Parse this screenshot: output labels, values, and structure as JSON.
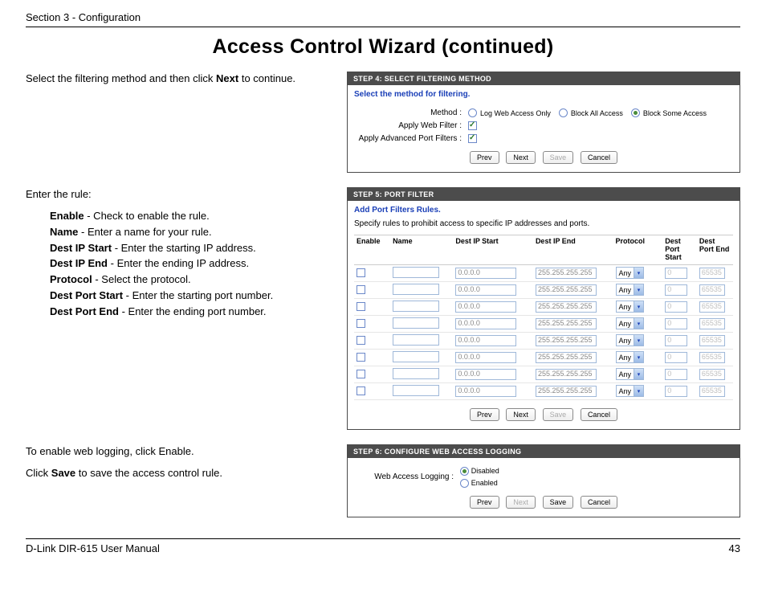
{
  "header": {
    "section": "Section 3 - Configuration"
  },
  "title": "Access Control Wizard (continued)",
  "left": {
    "intro_pre": "Select the filtering method and then click ",
    "intro_bold": "Next",
    "intro_post": " to continue.",
    "rule_intro": "Enter the rule:",
    "defs": [
      {
        "term": "Enable",
        "desc": " - Check to enable the rule."
      },
      {
        "term": "Name",
        "desc": " - Enter a name for your rule."
      },
      {
        "term": "Dest IP Start",
        "desc": " - Enter the starting IP address."
      },
      {
        "term": "Dest IP End",
        "desc": " - Enter the ending IP address."
      },
      {
        "term": "Protocol",
        "desc": " - Select the protocol."
      },
      {
        "term": "Dest Port Start",
        "desc": " - Enter the starting port number."
      },
      {
        "term": "Dest Port End",
        "desc": " - Enter the ending port number."
      }
    ],
    "logging_p1": "To enable web logging, click Enable.",
    "logging_p2_pre": "Click ",
    "logging_p2_bold": "Save",
    "logging_p2_post": " to save the access control rule."
  },
  "step4": {
    "title": "STEP 4: SELECT FILTERING METHOD",
    "subtitle": "Select the method for filtering.",
    "method_label": "Method :",
    "options": [
      "Log Web Access Only",
      "Block All Access",
      "Block Some Access"
    ],
    "selected": 2,
    "apply_web_label": "Apply Web Filter :",
    "apply_web_checked": true,
    "apply_port_label": "Apply Advanced Port Filters :",
    "apply_port_checked": true,
    "buttons": {
      "prev": "Prev",
      "next": "Next",
      "save": "Save",
      "cancel": "Cancel"
    }
  },
  "step5": {
    "title": "STEP 5: PORT FILTER",
    "subtitle": "Add Port Filters Rules.",
    "desc": "Specify rules to prohibit access to specific IP addresses and ports.",
    "headers": {
      "enable": "Enable",
      "name": "Name",
      "ip_start": "Dest IP Start",
      "ip_end": "Dest IP End",
      "protocol": "Protocol",
      "port_start": "Dest Port Start",
      "port_end": "Dest Port End"
    },
    "row_defaults": {
      "ip_start": "0.0.0.0",
      "ip_end": "255.255.255.255",
      "protocol": "Any",
      "port_start": "0",
      "port_end": "65535"
    },
    "row_count": 8,
    "buttons": {
      "prev": "Prev",
      "next": "Next",
      "save": "Save",
      "cancel": "Cancel"
    }
  },
  "step6": {
    "title": "STEP 6: CONFIGURE WEB ACCESS LOGGING",
    "label": "Web Access Logging :",
    "options": [
      "Disabled",
      "Enabled"
    ],
    "selected": 0,
    "buttons": {
      "prev": "Prev",
      "next": "Next",
      "save": "Save",
      "cancel": "Cancel"
    }
  },
  "footer": {
    "left": "D-Link DIR-615 User Manual",
    "right": "43"
  }
}
